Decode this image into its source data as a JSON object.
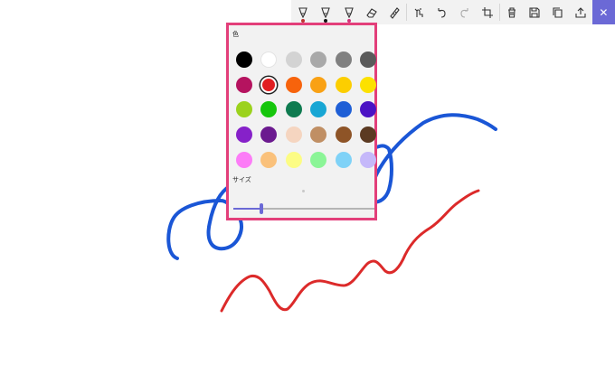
{
  "strokes": [
    {
      "name": "blue",
      "color": "#1a56d6"
    },
    {
      "name": "red",
      "color": "#dc2a2a"
    }
  ],
  "toolbar": {
    "buttons": [
      {
        "name": "ballpoint-pen-button",
        "icon": "ballpoint-pen-icon",
        "glyph": "pen",
        "dot_color": "#c0312f"
      },
      {
        "name": "pencil-button",
        "icon": "pencil-icon",
        "glyph": "pen",
        "dot_color": "#111111"
      },
      {
        "name": "highlighter-button",
        "icon": "highlighter-icon",
        "glyph": "pen",
        "dot_color": "#d4317a"
      },
      {
        "name": "eraser-button",
        "icon": "eraser-icon",
        "glyph": "eraser"
      },
      {
        "name": "ruler-button",
        "icon": "ruler-icon",
        "glyph": "ruler"
      },
      {
        "name": "touch-writing-button",
        "icon": "touch-writing-icon",
        "glyph": "touch"
      },
      {
        "name": "undo-button",
        "icon": "undo-icon",
        "glyph": "undo"
      },
      {
        "name": "redo-button",
        "icon": "redo-icon",
        "glyph": "redo"
      },
      {
        "name": "crop-button",
        "icon": "crop-icon",
        "glyph": "crop"
      },
      {
        "name": "delete-button",
        "icon": "trash-icon",
        "glyph": "trash"
      },
      {
        "name": "save-button",
        "icon": "save-icon",
        "glyph": "save"
      },
      {
        "name": "copy-button",
        "icon": "copy-icon",
        "glyph": "copy"
      },
      {
        "name": "share-button",
        "icon": "share-icon",
        "glyph": "share"
      }
    ],
    "close_glyph": "✕"
  },
  "color_panel": {
    "color_label": "色",
    "size_label": "サイズ",
    "border_color": "#e33f7a",
    "selected_index": 7,
    "size_value": 0.2,
    "colors": [
      "#000000",
      "#ffffff",
      "#d3d3d3",
      "#a9a9a9",
      "#808080",
      "#5a5a5a",
      "#b5135f",
      "#e11f22",
      "#f7630c",
      "#f9a114",
      "#fcce00",
      "#fce100",
      "#9bd21d",
      "#16c60c",
      "#0f7b50",
      "#18a6d4",
      "#1f5fd6",
      "#4b13c4",
      "#8621c9",
      "#6b1a8f",
      "#f5d5c0",
      "#c08f64",
      "#8e5427",
      "#5b3a22",
      "#fc7cf7",
      "#fac17b",
      "#fcfc84",
      "#8bf597",
      "#7fd2f7",
      "#c5b8fa"
    ]
  }
}
